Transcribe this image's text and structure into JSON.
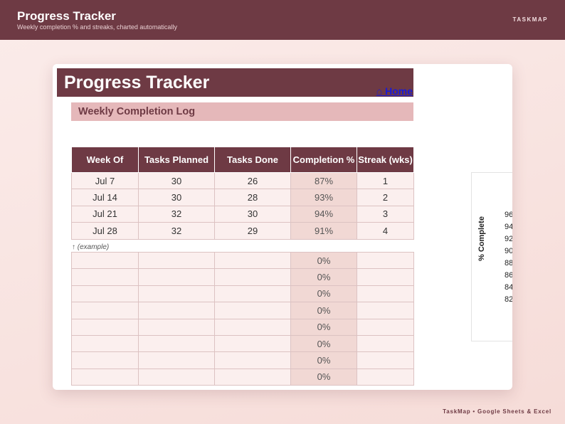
{
  "header": {
    "title": "Progress Tracker",
    "subtitle": "Weekly completion % and streaks, charted automatically",
    "brand": "TASKMAP"
  },
  "sheet": {
    "title": "Progress Tracker",
    "home_link": "⌂ Home",
    "section_title": "Weekly Completion Log",
    "columns": [
      "Week Of",
      "Tasks Planned",
      "Tasks Done",
      "Completion %",
      "Streak (wks)"
    ],
    "example_rows": [
      [
        "Jul 7",
        "30",
        "26",
        "87%",
        "1"
      ],
      [
        "Jul 14",
        "30",
        "28",
        "93%",
        "2"
      ],
      [
        "Jul 21",
        "32",
        "30",
        "94%",
        "3"
      ],
      [
        "Jul 28",
        "32",
        "29",
        "91%",
        "4"
      ]
    ],
    "example_note": "↑ (example)",
    "empty_rows_pct": [
      "0%",
      "0%",
      "0%",
      "0%",
      "0%",
      "0%",
      "0%",
      "0%"
    ]
  },
  "chart": {
    "ylabel": "% Complete",
    "ticks": [
      "96",
      "94",
      "92",
      "90",
      "88",
      "86",
      "84",
      "82"
    ]
  },
  "footer": {
    "text": "TaskMap  •  Google Sheets & Excel"
  }
}
